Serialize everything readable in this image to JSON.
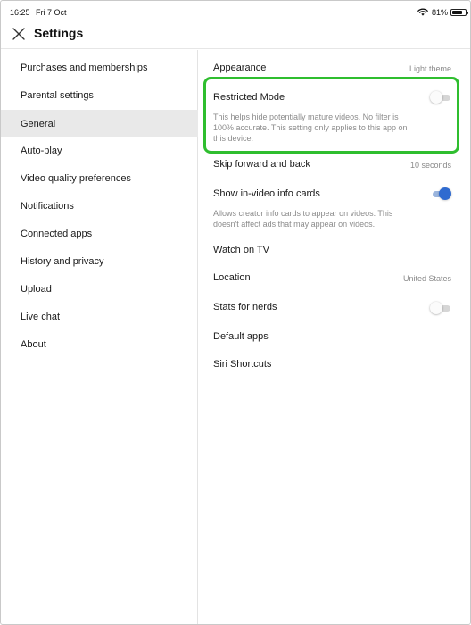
{
  "status_bar": {
    "time": "16:25",
    "date": "Fri 7 Oct",
    "battery": "81%",
    "battery_level": 0.81,
    "wifi_icon": "wifi-icon"
  },
  "header": {
    "close_icon": "close-icon",
    "title": "Settings"
  },
  "sidebar": {
    "items": [
      {
        "label": "Purchases and memberships"
      },
      {
        "label": "Parental settings"
      },
      {
        "label": "General",
        "active": true
      },
      {
        "label": "Auto-play"
      },
      {
        "label": "Video quality preferences"
      },
      {
        "label": "Notifications"
      },
      {
        "label": "Connected apps"
      },
      {
        "label": "History and privacy"
      },
      {
        "label": "Upload"
      },
      {
        "label": "Live chat"
      },
      {
        "label": "About"
      }
    ]
  },
  "general": {
    "appearance": {
      "title": "Appearance",
      "value": "Light theme"
    },
    "restricted_mode": {
      "title": "Restricted Mode",
      "description": "This helps hide potentially mature videos. No filter is 100% accurate. This setting only applies to this app on this device.",
      "enabled": false
    },
    "skip": {
      "title": "Skip forward and back",
      "value": "10 seconds"
    },
    "info_cards": {
      "title": "Show in-video info cards",
      "description": "Allows creator info cards to appear on videos. This doesn't affect ads that may appear on videos.",
      "enabled": true
    },
    "watch_on_tv": {
      "title": "Watch on TV"
    },
    "location": {
      "title": "Location",
      "value": "United States"
    },
    "stats_for_nerds": {
      "title": "Stats for nerds",
      "enabled": false
    },
    "default_apps": {
      "title": "Default apps"
    },
    "siri_shortcuts": {
      "title": "Siri Shortcuts"
    }
  },
  "colors": {
    "highlight": "#2fbe2f",
    "toggle_on": "#2f6bd0",
    "active_item_bg": "#e9e9e9"
  }
}
